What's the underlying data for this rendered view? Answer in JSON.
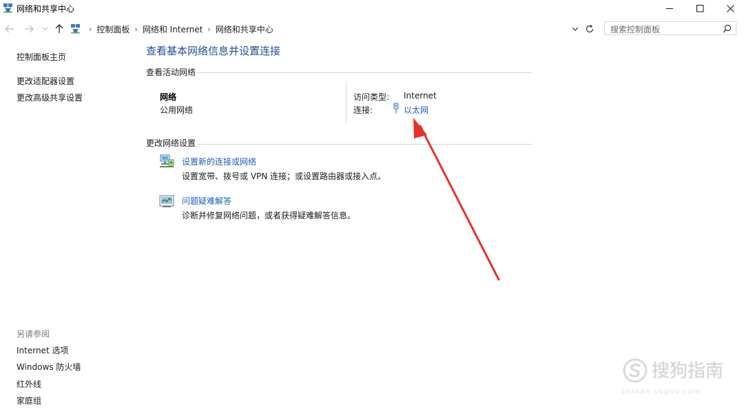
{
  "window": {
    "title": "网络和共享中心"
  },
  "breadcrumbs": [
    "控制面板",
    "网络和 Internet",
    "网络和共享中心"
  ],
  "search": {
    "placeholder": "搜索控制面板"
  },
  "sidebar": {
    "items": [
      {
        "label": "控制面板主页"
      },
      {
        "label": "更改适配器设置"
      },
      {
        "label": "更改高级共享设置"
      }
    ],
    "see_also_title": "另请参阅",
    "see_also": [
      {
        "label": "Internet 选项"
      },
      {
        "label": "Windows 防火墙"
      },
      {
        "label": "红外线"
      },
      {
        "label": "家庭组"
      }
    ]
  },
  "main": {
    "title": "查看基本网络信息并设置连接",
    "active_networks": {
      "heading": "查看活动网络",
      "network_name": "网络",
      "network_type": "公用网络",
      "access_type_label": "访问类型:",
      "access_type_value": "Internet",
      "connections_label": "连接:",
      "connection_link": "以太网"
    },
    "change_settings": {
      "heading": "更改网络设置",
      "tasks": [
        {
          "link": "设置新的连接或网络",
          "desc": "设置宽带、拨号或 VPN 连接；或设置路由器或接入点。",
          "icon": "network-setup-icon"
        },
        {
          "link": "问题疑难解答",
          "desc": "诊断并修复网络问题，或者获得疑难解答信息。",
          "icon": "troubleshoot-icon"
        }
      ]
    }
  },
  "watermark": {
    "text": "搜狗指南",
    "url": "zhinan.sogou.com"
  },
  "colors": {
    "title_blue": "#1e4f9a",
    "link_blue": "#1e5fb8",
    "annotation_red": "#e8302a"
  }
}
